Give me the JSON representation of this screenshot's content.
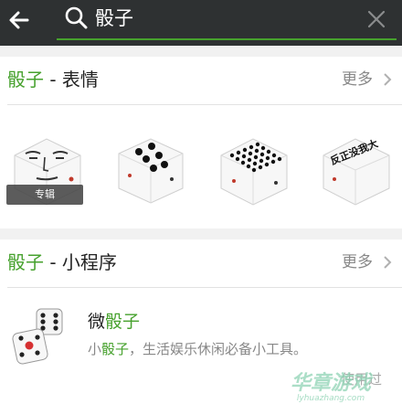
{
  "search": {
    "query": "骰子"
  },
  "sections": {
    "emoji": {
      "title_keyword": "骰子",
      "title_suffix": " - 表情",
      "more_label": "更多",
      "album_badge": "专辑",
      "face_text": "反正没我大"
    },
    "mini_program": {
      "title_keyword": "骰子",
      "title_suffix": " - 小程序",
      "more_label": "更多",
      "app": {
        "name_prefix": "微",
        "name_keyword": "骰子",
        "desc_prefix": "小",
        "desc_keyword": "骰子",
        "desc_suffix": "，生活娱乐休闲必备小工具。",
        "used_label": "使用过"
      }
    }
  },
  "watermark": {
    "text": "华章游戏",
    "subtext": "lyhuazhang.com"
  },
  "colors": {
    "topbar": "#2e3132",
    "accent": "#46a12d"
  }
}
